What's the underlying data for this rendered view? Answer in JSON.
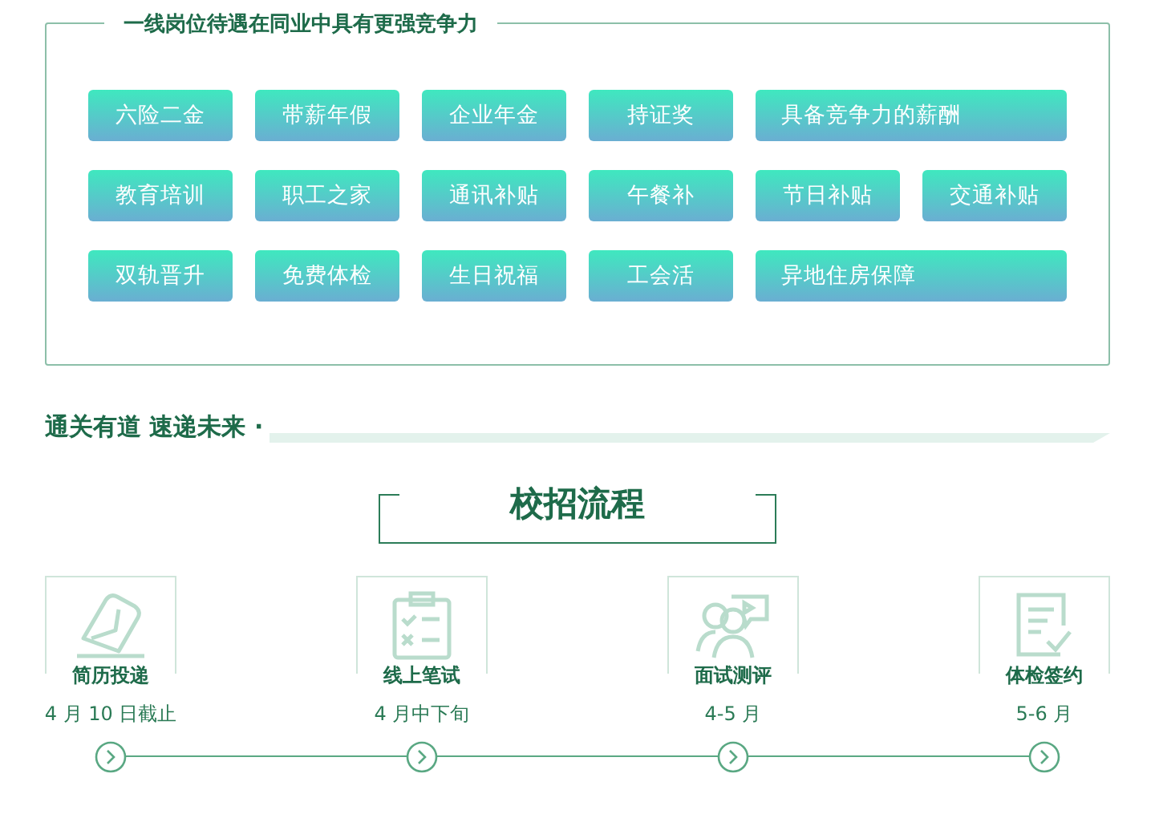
{
  "benefits": {
    "title": "一线岗位待遇在同业中具有更强竞争力",
    "tags": [
      {
        "label": "六险二金",
        "kind": "normal"
      },
      {
        "label": "带薪年假",
        "kind": "normal"
      },
      {
        "label": "企业年金",
        "kind": "normal"
      },
      {
        "label": "持证奖",
        "kind": "normal"
      },
      {
        "label": "具备竞争力的薪酬",
        "kind": "wide"
      },
      {
        "label": "教育培训",
        "kind": "normal"
      },
      {
        "label": "职工之家",
        "kind": "normal"
      },
      {
        "label": "通讯补贴",
        "kind": "normal"
      },
      {
        "label": "午餐补",
        "kind": "normal"
      },
      {
        "label": "节日补贴",
        "kind": "normal"
      },
      {
        "label": "交通补贴",
        "kind": "normal"
      },
      {
        "label": "双轨晋升",
        "kind": "normal"
      },
      {
        "label": "免费体检",
        "kind": "normal"
      },
      {
        "label": "生日祝福",
        "kind": "normal"
      },
      {
        "label": "工会活",
        "kind": "normal"
      },
      {
        "label": "异地住房保障",
        "kind": "wide"
      }
    ]
  },
  "section_heading": "通关有道 速递未来 ·",
  "process": {
    "title": "校招流程",
    "steps": [
      {
        "kind": "resume",
        "name": "简历投递",
        "date": "4 月 10 日截止"
      },
      {
        "kind": "test",
        "name": "线上笔试",
        "date": "4 月中下旬"
      },
      {
        "kind": "interview",
        "name": "面试测评",
        "date": "4-5 月"
      },
      {
        "kind": "sign",
        "name": "体检签约",
        "date": "5-6 月"
      }
    ]
  }
}
